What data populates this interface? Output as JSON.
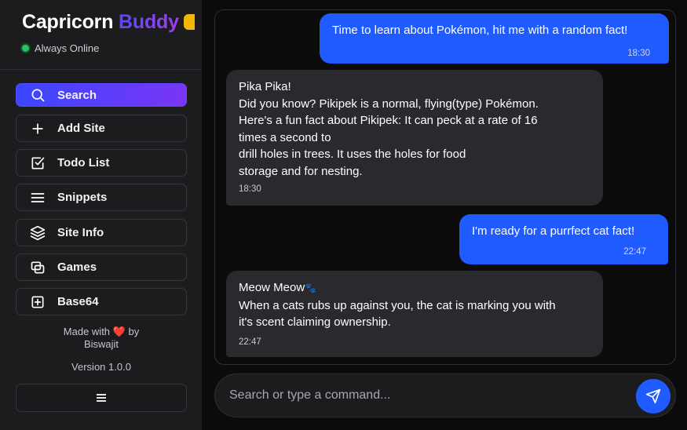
{
  "sidebar": {
    "brand_part1": "Capricorn",
    "brand_part2": "Buddy",
    "status": "Always Online",
    "items": [
      {
        "label": "Search",
        "icon": "search-icon"
      },
      {
        "label": "Add Site",
        "icon": "plus-icon"
      },
      {
        "label": "Todo List",
        "icon": "checkbox-icon"
      },
      {
        "label": "Snippets",
        "icon": "menu-lines-icon"
      },
      {
        "label": "Site Info",
        "icon": "layers-icon"
      },
      {
        "label": "Games",
        "icon": "windows-icon"
      },
      {
        "label": "Base64",
        "icon": "plus-square-icon"
      }
    ],
    "made_with_prefix": "Made with",
    "made_with_suffix": "by",
    "author": "Biswajit",
    "version": "Version 1.0.0"
  },
  "messages": [
    {
      "role": "user",
      "text": "Time to learn about Pokémon, hit me with a random fact!",
      "time": "18:30"
    },
    {
      "role": "bot",
      "lines": [
        "Pika Pika!",
        "Did you know? Pikipek is a normal, flying(type) Pokémon.",
        "Here's a fun fact about Pikipek: It can peck at a rate of 16",
        "times a second to",
        "drill holes in trees. It uses the holes for food",
        "storage and for nesting."
      ],
      "time": "18:30"
    },
    {
      "role": "user",
      "text": "I'm ready for a purrfect cat fact!",
      "time": "22:47"
    },
    {
      "role": "bot",
      "lines": [
        "Meow Meow",
        "When a cats rubs up against you, the cat is marking you with",
        "it's scent claiming ownership."
      ],
      "time": "22:47"
    }
  ],
  "composer": {
    "placeholder": "Search or type a command..."
  },
  "colors": {
    "accent": "#1f5bff",
    "sidebar": "#1c1c1f",
    "bot_bubble": "#2a2a2e",
    "online": "#22c55e"
  }
}
